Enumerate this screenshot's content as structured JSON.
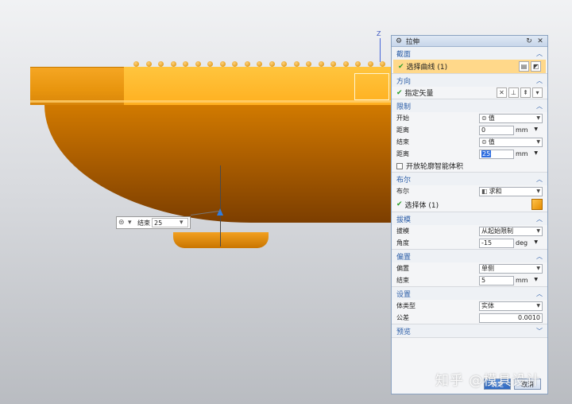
{
  "viewport": {
    "axis_label": "Z",
    "onscreen_input": {
      "label": "结束",
      "value": "25"
    }
  },
  "dialog": {
    "title": "拉伸",
    "sections": {
      "section_curve": {
        "title": "截面",
        "select_curve": "选择曲线 (1)"
      },
      "direction": {
        "title": "方向",
        "specify_vector": "指定矢量"
      },
      "limits": {
        "title": "限制",
        "start_label": "开始",
        "start_value": "值",
        "distance1_label": "距离",
        "distance1_value": "0",
        "distance1_unit": "mm",
        "end_label": "结束",
        "end_value": "值",
        "distance2_label": "距离",
        "distance2_value": "25",
        "distance2_unit": "mm",
        "open_profile": "开放轮廓智能体积"
      },
      "boolean": {
        "title": "布尔",
        "bool_label": "布尔",
        "bool_value": "求和",
        "select_body": "选择体 (1)"
      },
      "draft": {
        "title": "拔模",
        "draft_label": "拔模",
        "draft_value": "从起始限制",
        "angle_label": "角度",
        "angle_value": "-15",
        "angle_unit": "deg"
      },
      "offset": {
        "title": "偏置",
        "offset_label": "偏置",
        "offset_value": "单侧",
        "end_label": "结束",
        "end_value": "5",
        "end_unit": "mm"
      },
      "settings": {
        "title": "设置",
        "body_type_label": "体类型",
        "body_type_value": "实体",
        "tolerance_label": "公差",
        "tolerance_value": "0.0010"
      },
      "preview": {
        "title": "预览"
      }
    },
    "footer": {
      "ok": "确定",
      "cancel": "取消"
    }
  },
  "watermark": "知乎 @模具设计",
  "colors": {
    "part_orange": "#f5a623",
    "dialog_header": "#2c5ea8",
    "check_green": "#2a9d2a"
  }
}
